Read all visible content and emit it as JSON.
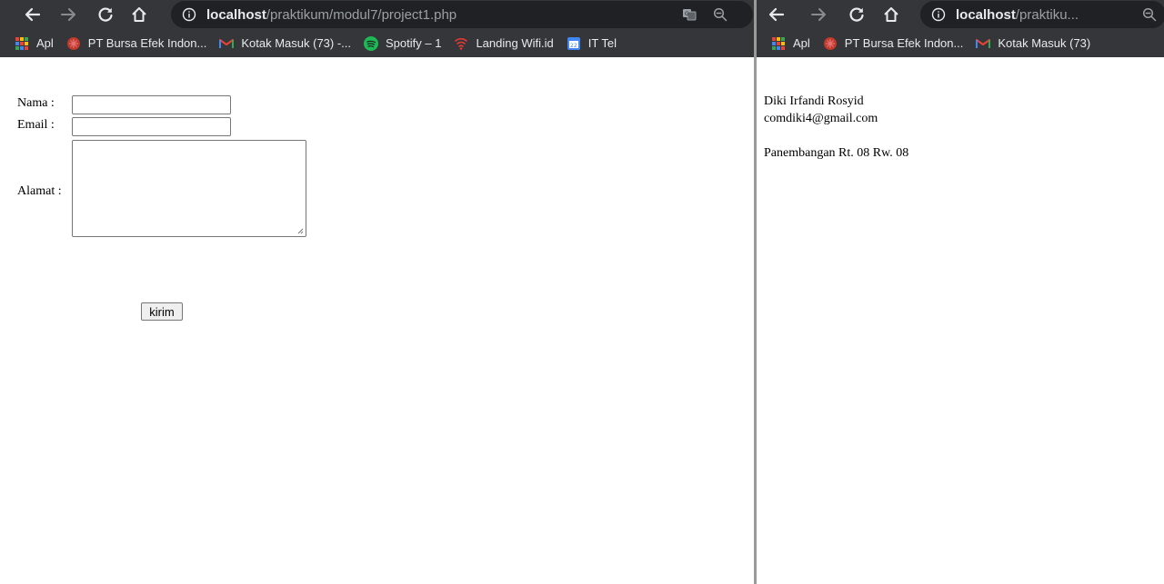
{
  "left_window": {
    "url_host": "localhost",
    "url_path": "/praktikum/modul7/project1.php",
    "bookmarks": [
      {
        "label": "Apl",
        "icon": "apps-grid-icon"
      },
      {
        "label": "PT Bursa Efek Indon...",
        "icon": "bursa-efek-icon"
      },
      {
        "label": "Kotak Masuk (73) -...",
        "icon": "gmail-icon"
      },
      {
        "label": "Spotify – 1",
        "icon": "spotify-icon"
      },
      {
        "label": "Landing Wifi.id",
        "icon": "wifi-id-icon"
      },
      {
        "label": "IT Tel",
        "icon": "calendar-icon"
      }
    ],
    "form": {
      "nama_label": "Nama :",
      "email_label": "Email :",
      "alamat_label": "Alamat :",
      "nama_value": "",
      "email_value": "",
      "alamat_value": "",
      "submit_label": "kirim"
    }
  },
  "right_window": {
    "url_host": "localhost",
    "url_path": "/praktiku...",
    "bookmarks": [
      {
        "label": "Apl",
        "icon": "apps-grid-icon"
      },
      {
        "label": "PT Bursa Efek Indon...",
        "icon": "bursa-efek-icon"
      },
      {
        "label": "Kotak Masuk (73)",
        "icon": "gmail-icon"
      }
    ],
    "output": {
      "nama": "Diki Irfandi Rosyid",
      "email": "comdiki4@gmail.com",
      "alamat": "Panembangan Rt. 08 Rw. 08"
    }
  },
  "colors": {
    "toolbar_bg": "#35363a",
    "omnibox_bg": "#202124",
    "toolbar_text": "#e8eaed",
    "url_path_text": "#9aa0a6"
  }
}
